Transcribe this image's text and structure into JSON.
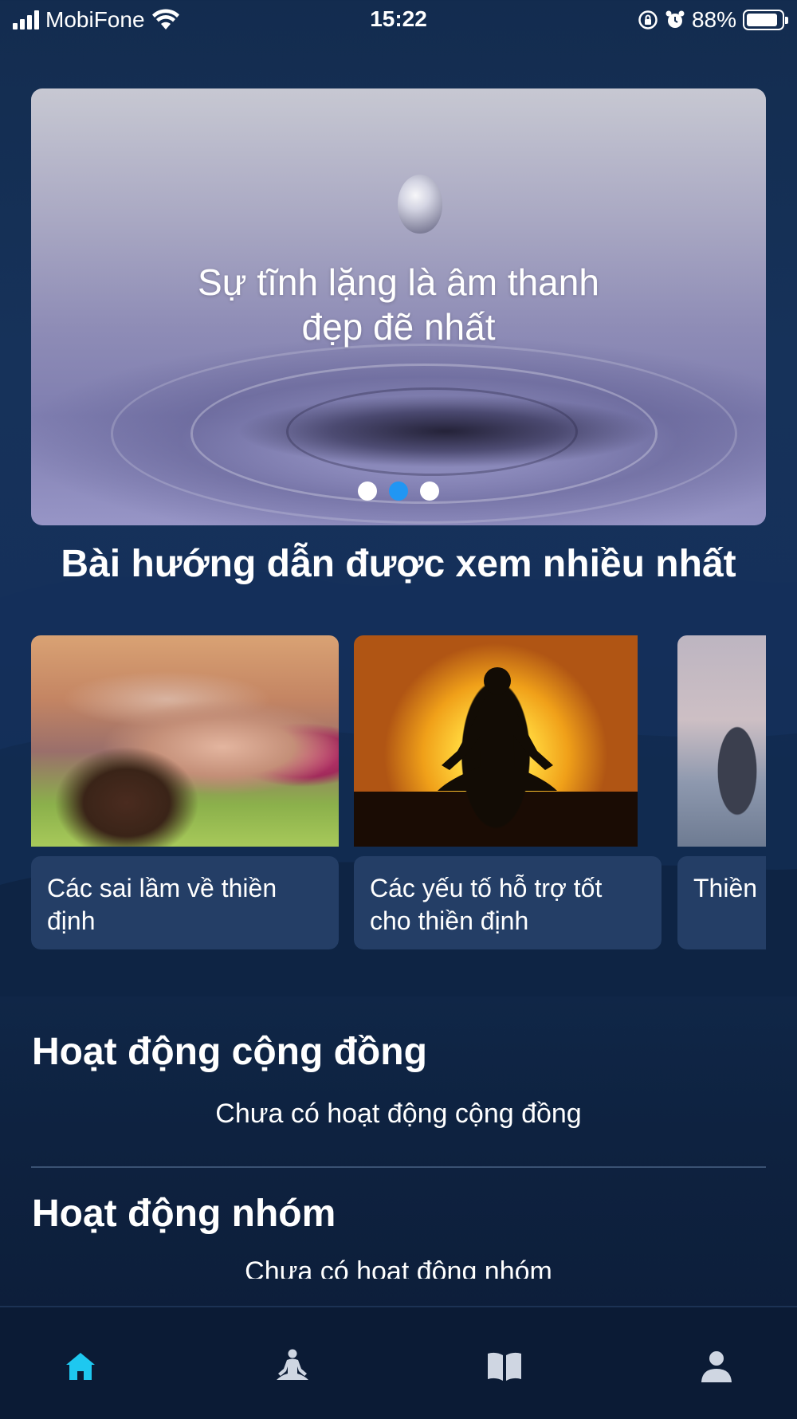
{
  "status_bar": {
    "carrier": "MobiFone",
    "time": "15:22",
    "battery": "88%",
    "battery_level": 0.88
  },
  "hero": {
    "quote_line1": "Sự tĩnh lặng là âm thanh",
    "quote_line2": "đẹp đẽ nhất",
    "slides": 3,
    "active_slide": 1
  },
  "popular": {
    "title": "Bài hướng dẫn được xem nhiều nhất",
    "cards": [
      {
        "caption_line1": "Các sai lầm về thiền",
        "caption_line2": "định"
      },
      {
        "caption_line1": "Các yếu tố hỗ trợ tốt",
        "caption_line2": "cho thiền định"
      },
      {
        "caption_line1": "Thiền",
        "caption_line2": ""
      }
    ]
  },
  "community": {
    "title": "Hoạt động cộng đồng",
    "empty": "Chưa có hoạt động cộng đồng"
  },
  "group": {
    "title": "Hoạt động nhóm",
    "empty": "Chưa có hoạt động nhóm"
  },
  "bottom_nav": {
    "items": [
      "home-icon",
      "meditation-icon",
      "book-icon",
      "profile-icon"
    ],
    "active": "home-icon",
    "active_color": "#1ec8f0",
    "inactive_color": "#cfd6e2"
  }
}
